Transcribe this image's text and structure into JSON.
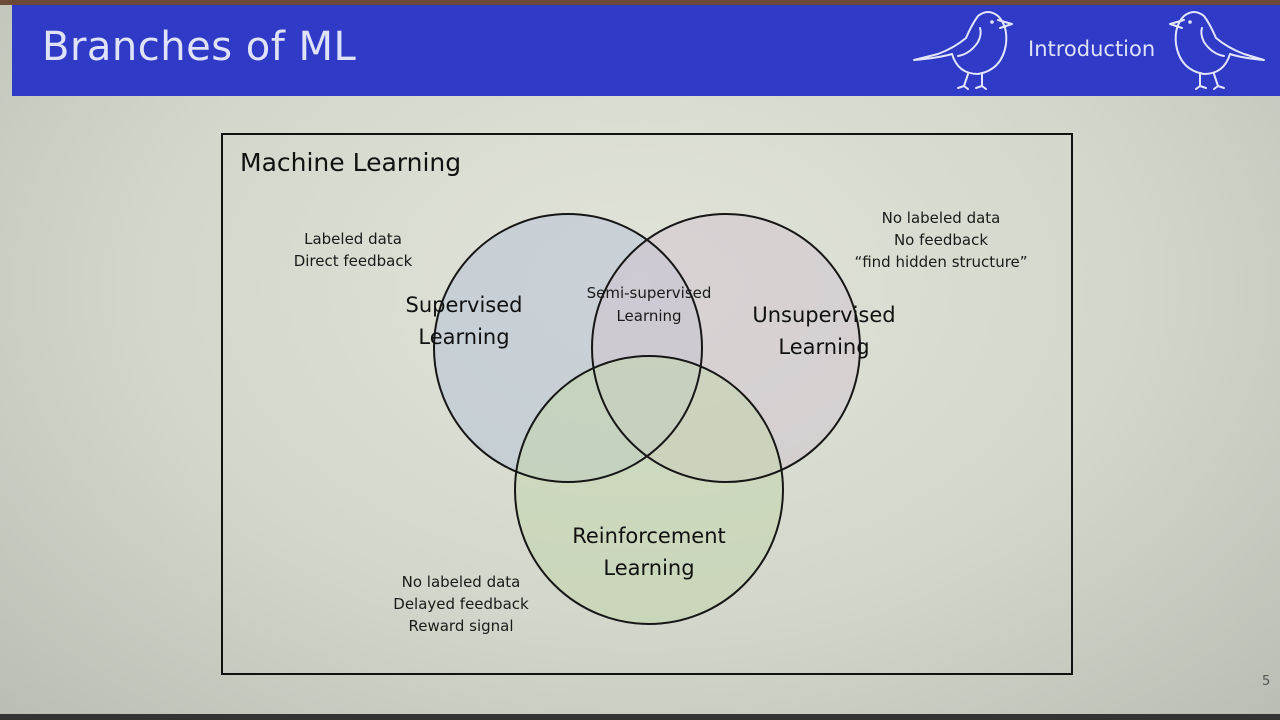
{
  "header": {
    "title": "Branches of ML",
    "section": "Introduction",
    "background_color": "#2f3ac6"
  },
  "diagram": {
    "frame_title": "Machine Learning",
    "circles": {
      "supervised": {
        "line1": "Supervised",
        "line2": "Learning",
        "fill_color": "#b7c3d6"
      },
      "unsupervised": {
        "line1": "Unsupervised",
        "line2": "Learning",
        "fill_color": "#d2c4cf"
      },
      "reinforcement": {
        "line1": "Reinforcement",
        "line2": "Learning",
        "fill_color": "#c3d6ad"
      }
    },
    "overlap": {
      "line1": "Semi-supervised",
      "line2": "Learning"
    },
    "notes": {
      "supervised": [
        "Labeled data",
        "Direct feedback"
      ],
      "unsupervised": [
        "No labeled data",
        "No feedback",
        "“find hidden structure”"
      ],
      "reinforcement": [
        "No labeled data",
        "Delayed feedback",
        "Reward signal"
      ]
    }
  },
  "footer": {
    "page_number": "5"
  },
  "icons": [
    "bird-icon-left",
    "bird-icon-right"
  ]
}
